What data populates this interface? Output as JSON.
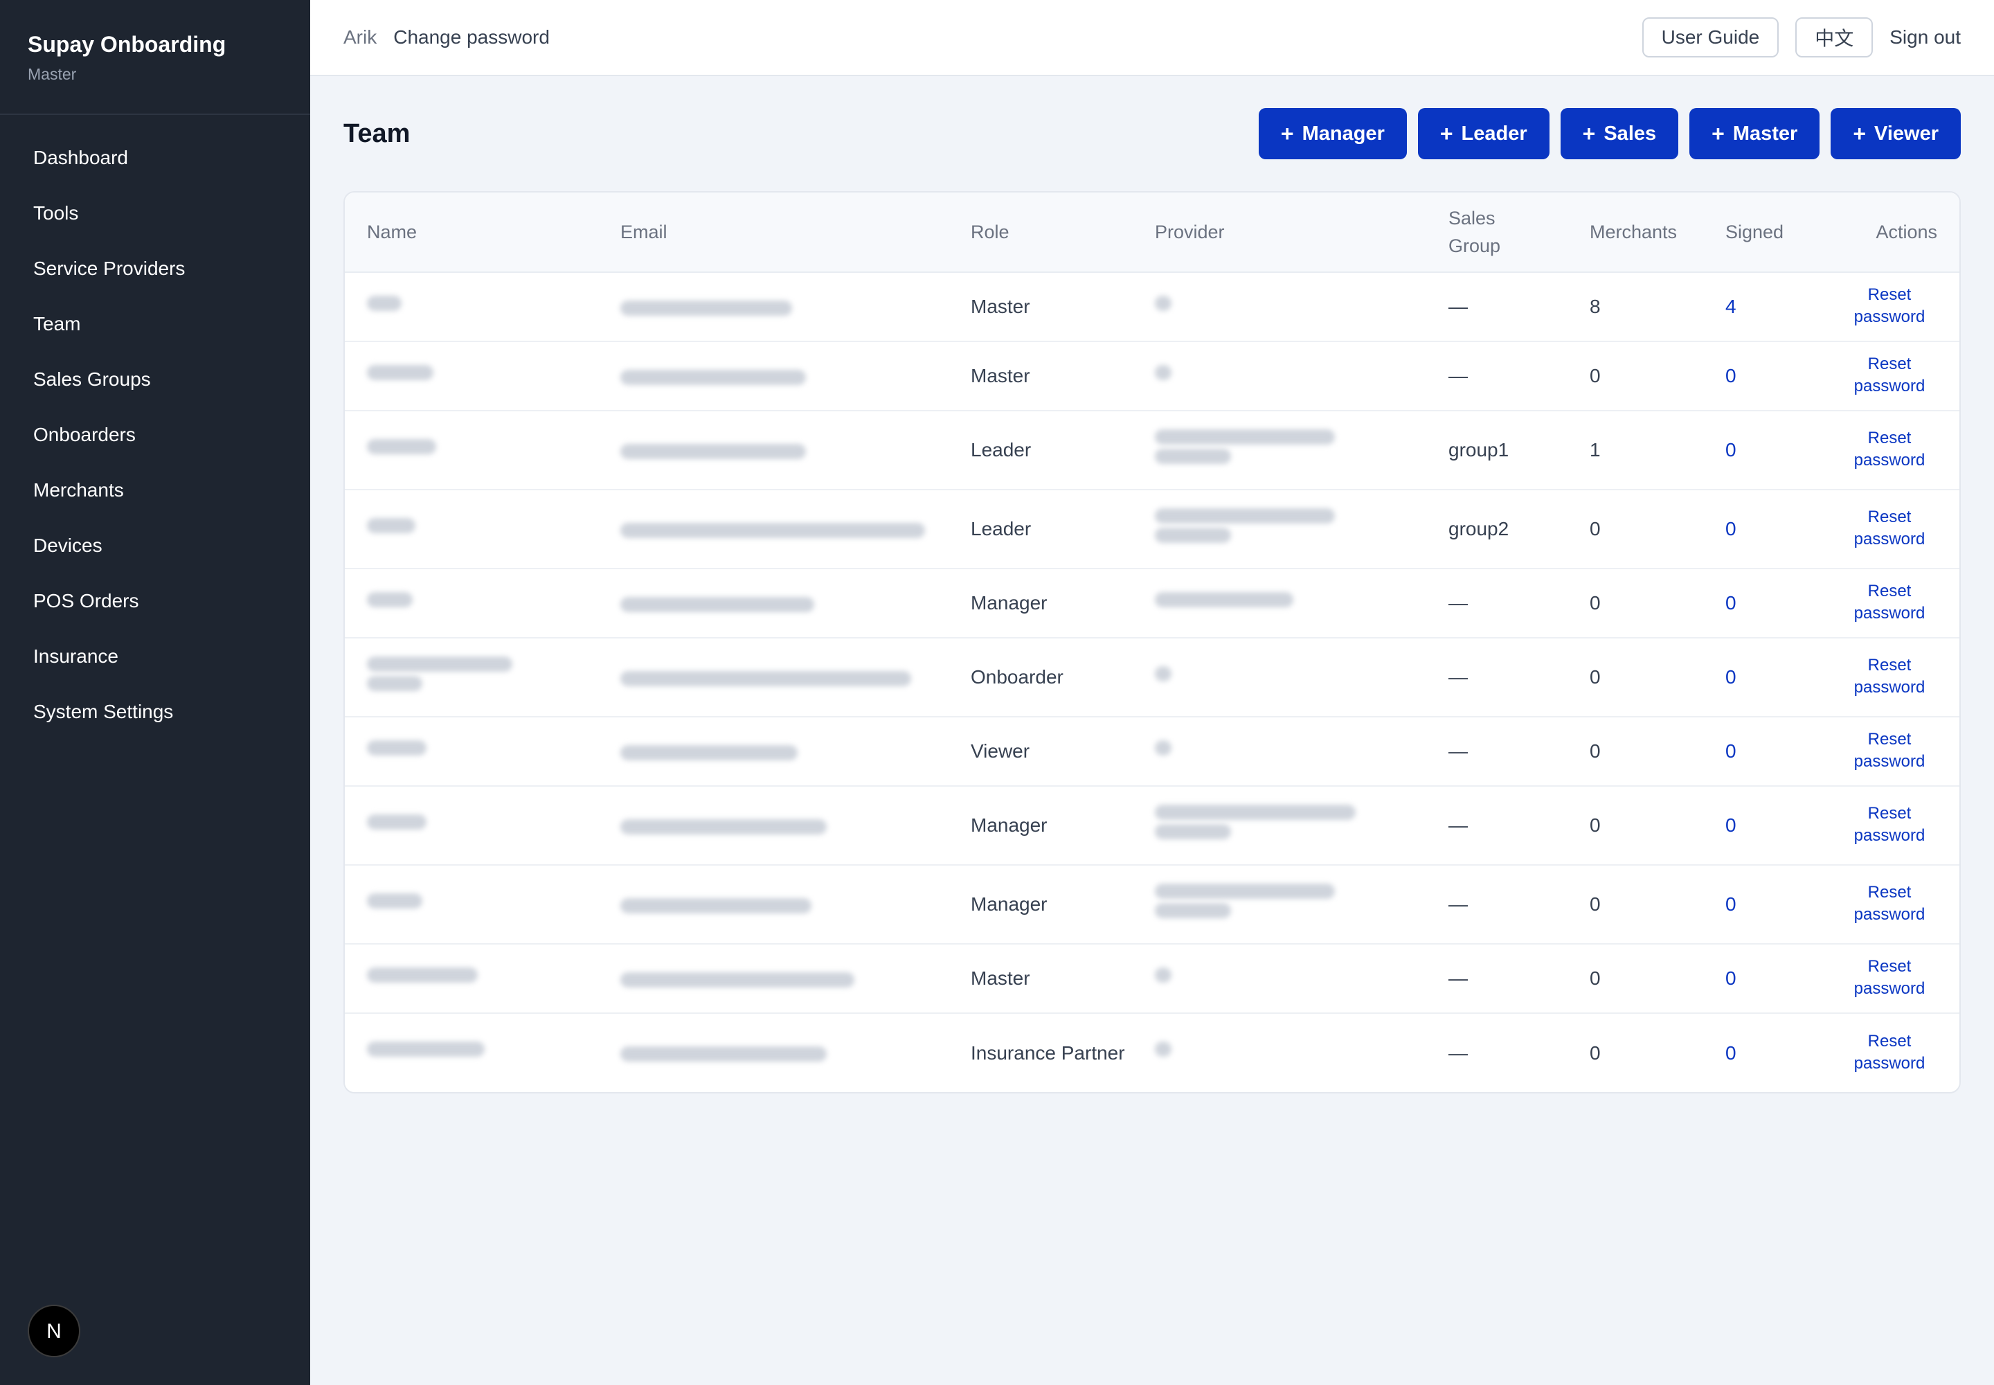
{
  "sidebar": {
    "brand_title": "Supay Onboarding",
    "brand_sub": "Master",
    "items": [
      {
        "label": "Dashboard"
      },
      {
        "label": "Tools"
      },
      {
        "label": "Service Providers"
      },
      {
        "label": "Team"
      },
      {
        "label": "Sales Groups"
      },
      {
        "label": "Onboarders"
      },
      {
        "label": "Merchants"
      },
      {
        "label": "Devices"
      },
      {
        "label": "POS Orders"
      },
      {
        "label": "Insurance"
      },
      {
        "label": "System Settings"
      }
    ],
    "badge_letter": "N"
  },
  "topbar": {
    "user": "Arik",
    "change_password": "Change password",
    "user_guide": "User Guide",
    "language": "中文",
    "sign_out": "Sign out"
  },
  "page": {
    "title": "Team",
    "add_buttons": [
      {
        "plus": "+",
        "label": "Manager"
      },
      {
        "plus": "+",
        "label": "Leader"
      },
      {
        "plus": "+",
        "label": "Sales"
      },
      {
        "plus": "+",
        "label": "Master"
      },
      {
        "plus": "+",
        "label": "Viewer"
      }
    ]
  },
  "table": {
    "headers": {
      "name": "Name",
      "email": "Email",
      "role": "Role",
      "provider": "Provider",
      "sales_group": "Sales Group",
      "merchants": "Merchants",
      "signed": "Signed",
      "actions": "Actions"
    },
    "reset_label": "Reset password",
    "rows": [
      {
        "role": "Master",
        "sales_group": "—",
        "merchants": "8",
        "signed": "4"
      },
      {
        "role": "Master",
        "sales_group": "—",
        "merchants": "0",
        "signed": "0"
      },
      {
        "role": "Leader",
        "sales_group": "group1",
        "merchants": "1",
        "signed": "0"
      },
      {
        "role": "Leader",
        "sales_group": "group2",
        "merchants": "0",
        "signed": "0"
      },
      {
        "role": "Manager",
        "sales_group": "—",
        "merchants": "0",
        "signed": "0"
      },
      {
        "role": "Onboarder",
        "sales_group": "—",
        "merchants": "0",
        "signed": "0"
      },
      {
        "role": "Viewer",
        "sales_group": "—",
        "merchants": "0",
        "signed": "0"
      },
      {
        "role": "Manager",
        "sales_group": "—",
        "merchants": "0",
        "signed": "0"
      },
      {
        "role": "Manager",
        "sales_group": "—",
        "merchants": "0",
        "signed": "0"
      },
      {
        "role": "Master",
        "sales_group": "—",
        "merchants": "0",
        "signed": "0"
      },
      {
        "role": "Insurance Partner",
        "sales_group": "—",
        "merchants": "0",
        "signed": "0"
      }
    ]
  }
}
